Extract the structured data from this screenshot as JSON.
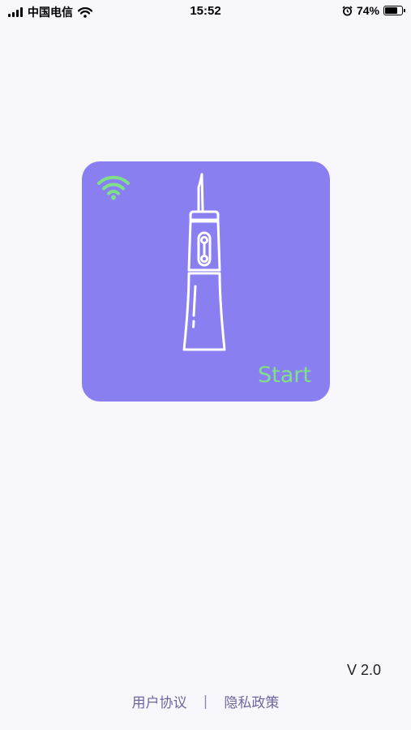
{
  "status_bar": {
    "carrier": "中国电信",
    "time": "15:52",
    "battery_percent": "74%",
    "battery_level": 0.74,
    "icons": [
      "signal-icon",
      "wifi-icon",
      "alarm-icon",
      "battery-icon"
    ]
  },
  "device_card": {
    "start_label": "Start",
    "connection_icon": "wifi-icon",
    "device_icon": "water-flosser-icon",
    "colors": {
      "card_background": "#8a7ff0",
      "wifi": "#7fe08a",
      "start_text": "#7fe08a",
      "outline": "#ffffff"
    }
  },
  "version": "V 2.0",
  "footer": {
    "user_agreement": "用户协议",
    "separator": "|",
    "privacy_policy": "隐私政策",
    "link_color": "#6e669e"
  },
  "page_background": "#f8f7fc"
}
